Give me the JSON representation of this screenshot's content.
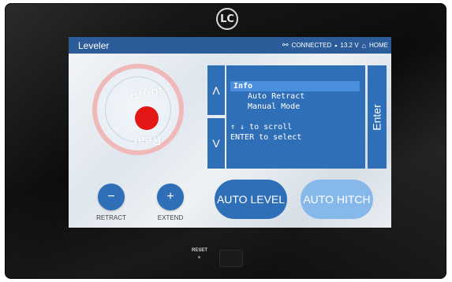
{
  "logo": {
    "text": "LC"
  },
  "header": {
    "title": "Leveler",
    "connection": "CONNECTED",
    "voltage": "13.2 V",
    "home": "HOME"
  },
  "orientation": {
    "front": "Front",
    "rear": "Rear"
  },
  "controls": {
    "retract_symbol": "−",
    "retract_label": "RETRACT",
    "extend_symbol": "+",
    "extend_label": "EXTEND"
  },
  "menu": {
    "up": "Λ",
    "down": "V",
    "items": [
      "Info",
      "Auto Retract",
      "Manual Mode"
    ],
    "selected_index": 0,
    "hint_scroll": "↑ ↓ to scroll",
    "hint_select": "ENTER to select",
    "enter": "Enter"
  },
  "actions": {
    "auto_level": "AUTO LEVEL",
    "auto_hitch": "AUTO HITCH"
  },
  "hardware": {
    "reset": "RESET"
  },
  "colors": {
    "accent": "#2f6fb8",
    "header": "#2c5d9a",
    "dot": "#e41616",
    "ring": "#f0b9b9",
    "hitch": "#86b9ea"
  }
}
